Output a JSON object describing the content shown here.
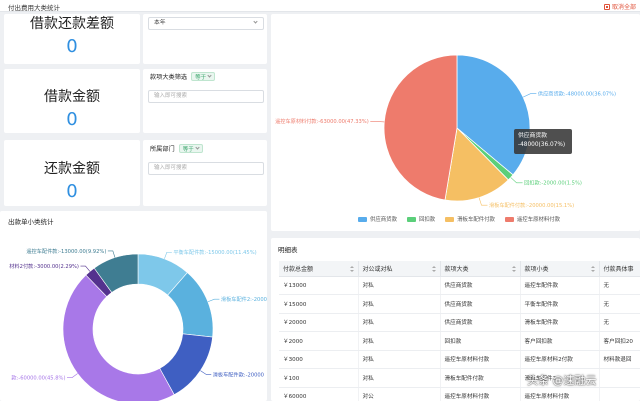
{
  "header": {
    "title": "付出费用大类统计",
    "reset_label": "取消全部"
  },
  "metrics": [
    {
      "label": "借款还款差额",
      "value": "0"
    },
    {
      "label": "借款金额",
      "value": "0"
    },
    {
      "label": "还款金额",
      "value": "0"
    }
  ],
  "filters": {
    "year_select": "本年",
    "category": {
      "title": "款项大类筛选",
      "operator": "等于",
      "placeholder": "输入即可搜索"
    },
    "department": {
      "title": "所属部门",
      "operator": "等于",
      "placeholder": "输入即可搜索"
    }
  },
  "pie_tooltip": {
    "name": "供应商货款",
    "value": "-48000(36.07%)"
  },
  "chart_data": [
    {
      "type": "pie",
      "series": [
        {
          "values": [
            -48000,
            -2000,
            -20000,
            -63000
          ]
        }
      ],
      "categories": [
        "供应商货款",
        "回扣款",
        "滑板车配件付款",
        "遥控车原材料付款"
      ],
      "labels": [
        "供应商货款:-48000.00(36.07%)",
        "回扣款:-2000.00(1.5%)",
        "滑板车配件付款:-20000.00(15.1%)",
        "遥控车原材料付款:-63000.00(47.33%)"
      ],
      "colors": [
        "#58acec",
        "#5bcf7a",
        "#f5bf63",
        "#ee7b6c"
      ],
      "legend": "bottom"
    },
    {
      "type": "pie",
      "title": "出款单小类统计",
      "values": [
        -15000,
        -20000,
        -20000,
        -60000,
        -3000,
        -13000
      ],
      "labels": [
        "平衡车配件款:-15000.00(11.45%)",
        "滑板车配件2:-20000",
        "滑板车配件款:-20000",
        "款:-60000.00(45.8%)",
        "材料2付款:-3000.00(2.29%)",
        "遥控车配件款:-13000.00(9.92%)"
      ],
      "colors": [
        "#7ec8ea",
        "#5ab1de",
        "#3f5fc2",
        "#a878e8",
        "#54328e",
        "#3f7d92"
      ]
    }
  ],
  "table": {
    "title": "明细表",
    "columns": [
      "付款总金额",
      "对公或对私",
      "款项大类",
      "款项小类",
      "付款具体事"
    ],
    "rows": [
      [
        "￥13000",
        "对私",
        "供应商货款",
        "遥控车配件款",
        "无"
      ],
      [
        "￥15000",
        "对私",
        "供应商货款",
        "平衡车配件款",
        "无"
      ],
      [
        "￥20000",
        "对私",
        "供应商货款",
        "滑板车配件款",
        "无"
      ],
      [
        "￥2000",
        "对私",
        "回扣款",
        "客户回扣款",
        "客户回扣20"
      ],
      [
        "￥3000",
        "对私",
        "遥控车原材料付款",
        "遥控车原材料2付款",
        "材料款退回"
      ],
      [
        "￥100",
        "对私",
        "滑板车配件付款",
        "滑板车配件2",
        ""
      ],
      [
        "￥60000",
        "对公",
        "遥控车原材料付款",
        "遥控车原材料付款",
        ""
      ]
    ]
  },
  "watermark": "头条 @速融云"
}
